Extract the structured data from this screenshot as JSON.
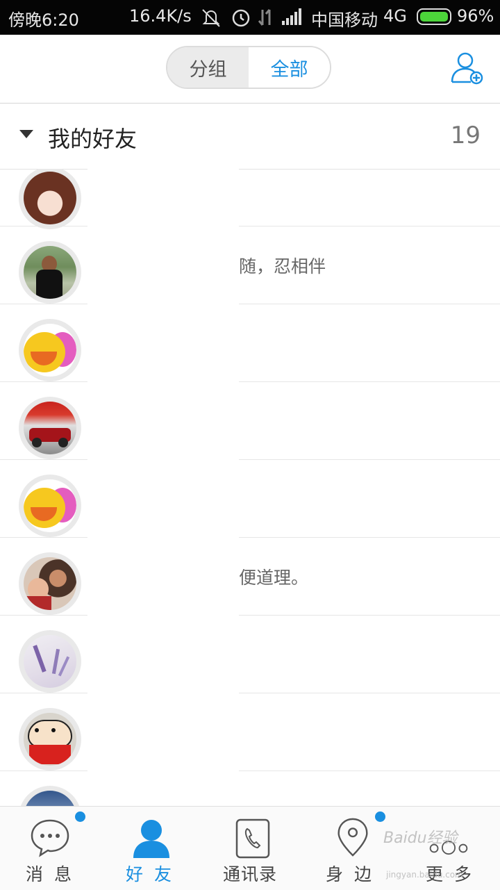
{
  "status_bar": {
    "time": "傍晚6:20",
    "speed": "16.4K/s",
    "carrier": "中国移动",
    "network": "4G",
    "battery": "96%"
  },
  "top_bar": {
    "seg_group": "分组",
    "seg_all": "全部",
    "add_icon": "add-friend-icon"
  },
  "group": {
    "title": "我的好友",
    "count": "19"
  },
  "friends": [
    {
      "status": ""
    },
    {
      "status": "随，忍相伴"
    },
    {
      "status": ""
    },
    {
      "status": ""
    },
    {
      "status": ""
    },
    {
      "status": "便道理。"
    },
    {
      "status": ""
    },
    {
      "status": ""
    },
    {
      "status": ""
    }
  ],
  "tabs": [
    {
      "label": "消 息",
      "icon": "chat-bubble-icon",
      "badge": true
    },
    {
      "label": "好 友",
      "icon": "person-icon",
      "active": true
    },
    {
      "label": "通讯录",
      "icon": "phone-icon"
    },
    {
      "label": "身 边",
      "icon": "location-pin-icon",
      "badge": true
    },
    {
      "label": "更 多",
      "icon": "more-circles-icon"
    }
  ],
  "watermark": {
    "text": "Baidu经验",
    "url": "jingyan.baidu.com"
  },
  "colors": {
    "accent": "#1a8fe0",
    "status_bar_bg": "#050505"
  }
}
